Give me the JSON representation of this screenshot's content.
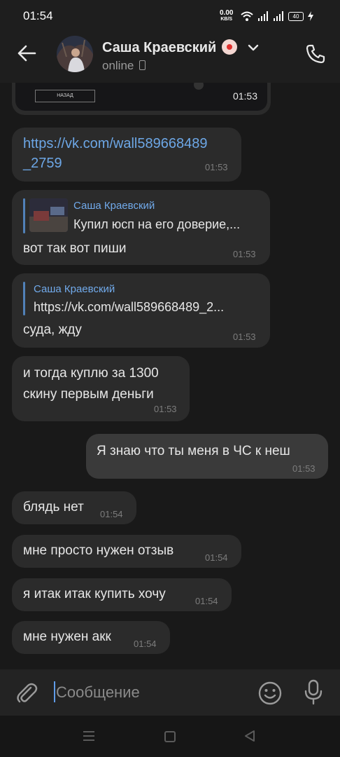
{
  "status_bar": {
    "time": "01:54",
    "speed_value": "0.00",
    "speed_unit": "KB/S",
    "battery": "40"
  },
  "header": {
    "name": "Саша Краевский",
    "status": "online"
  },
  "messages": {
    "media_time": "01:53",
    "media_button": "НАЗАД",
    "m1": {
      "text": "https://vk.com/wall589668489_2759",
      "line1": "https://vk.com/wall589668489",
      "line2": "_2759",
      "time": "01:53"
    },
    "m2": {
      "quote_author": "Саша Краевский",
      "quote_text": "Купил юсп на его доверие,...",
      "text": "вот так вот пиши",
      "time": "01:53"
    },
    "m3": {
      "quote_author": "Саша Краевский",
      "quote_text": "https://vk.com/wall589668489_2...",
      "text": "суда, жду",
      "time": "01:53"
    },
    "m4": {
      "line1": "и тогда куплю за 1300",
      "line2": "скину первым деньги",
      "time": "01:53"
    },
    "m5": {
      "text": "Я знаю что ты меня в ЧС к неш",
      "time": "01:53"
    },
    "m6": {
      "text": "блядь нет",
      "time": "01:54"
    },
    "m7": {
      "text": "мне просто нужен отзыв",
      "time": "01:54"
    },
    "m8": {
      "text": "я итак итак купить хочу",
      "time": "01:54"
    },
    "m9": {
      "text": "мне нужен акк",
      "time": "01:54"
    }
  },
  "composer": {
    "placeholder": "Сообщение"
  },
  "colors": {
    "background": "#191919",
    "bubble_in": "#2b2b2b",
    "bubble_out": "#3a3a3a",
    "link": "#6da7e6",
    "quote_name": "#71aaeb",
    "accent": "#5181b8"
  },
  "icons": [
    "back-arrow-icon",
    "chevron-down-icon",
    "phone-icon",
    "paperclip-icon",
    "smile-icon",
    "microphone-icon",
    "wifi-icon",
    "signal-icon",
    "battery-icon",
    "charging-icon",
    "menu-icon",
    "home-icon",
    "back-nav-icon"
  ]
}
